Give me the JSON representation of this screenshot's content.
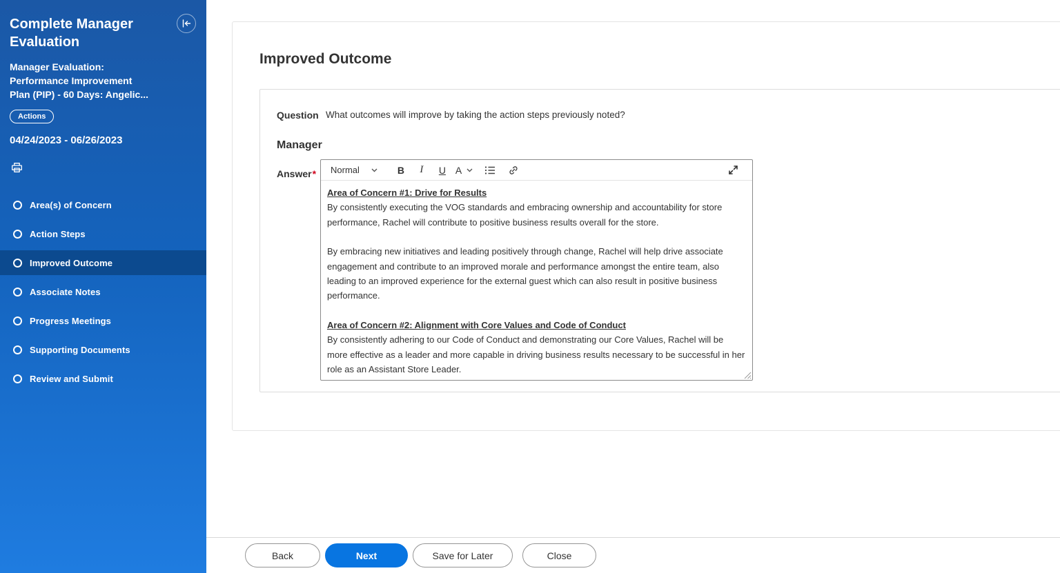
{
  "sidebar": {
    "title": "Complete Manager Evaluation",
    "subtitle": "Manager Evaluation:\nPerformance Improvement\nPlan (PIP) - 60 Days: Angelic...",
    "actions_label": "Actions",
    "date_range": "04/24/2023 - 06/26/2023",
    "steps": [
      {
        "label": "Area(s) of Concern",
        "active": false
      },
      {
        "label": "Action Steps",
        "active": false
      },
      {
        "label": "Improved Outcome",
        "active": true
      },
      {
        "label": "Associate Notes",
        "active": false
      },
      {
        "label": "Progress Meetings",
        "active": false
      },
      {
        "label": "Supporting Documents",
        "active": false
      },
      {
        "label": "Review and Submit",
        "active": false
      }
    ],
    "icons": {
      "collapse": "collapse-panel-left",
      "print": "printer"
    }
  },
  "main": {
    "page_title": "Improved Outcome",
    "question_label": "Question",
    "question_text": "What outcomes will improve by taking the action steps previously noted?",
    "section_heading": "Manager",
    "answer_label": "Answer",
    "required_marker": "*",
    "editor": {
      "toolbar": {
        "paragraph_style": "Normal",
        "bold": "B",
        "italic": "I",
        "underline": "U",
        "color": "A",
        "icons": [
          "chevron-down",
          "bullet-list",
          "link",
          "expand"
        ]
      },
      "content": [
        {
          "type": "heading",
          "text": "Area of Concern #1: Drive for Results"
        },
        {
          "type": "paragraph",
          "text": "By consistently executing the VOG standards and embracing ownership and accountability for store performance, Rachel will contribute to positive business results overall for the store."
        },
        {
          "type": "paragraph",
          "text": "By embracing new initiatives and leading positively through change, Rachel will help drive associate engagement and contribute to an improved morale and performance amongst the entire team, also leading to an improved experience for the external guest which can also result in positive business performance."
        },
        {
          "type": "heading",
          "text": "Area of Concern #2: Alignment with Core Values and Code of Conduct"
        },
        {
          "type": "paragraph",
          "text": "By consistently adhering to our Code of Conduct and demonstrating our Core Values, Rachel will be more effective as a leader and more capable in driving business results necessary to be successful in her role as an Assistant Store Leader."
        }
      ]
    }
  },
  "footer": {
    "back": "Back",
    "next": "Next",
    "save_for_later": "Save for Later",
    "close": "Close"
  },
  "colors": {
    "sidebar_gradient_top": "#1b58a6",
    "sidebar_gradient_bottom": "#1f7ce0",
    "active_step_bg": "#0c4a8f",
    "primary_button": "#0875e1",
    "required_red": "#d0021b"
  }
}
